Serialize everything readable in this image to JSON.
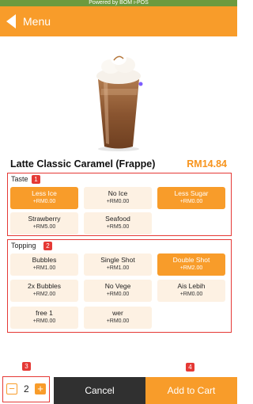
{
  "header": {
    "powered_by": "Powered by BOM i-POS",
    "back_label": "Menu"
  },
  "product": {
    "name": "Latte Classic Caramel (Frappe)",
    "price": "RM14.84"
  },
  "taste": {
    "label": "Taste",
    "badge": "1",
    "options": [
      {
        "name": "Less Ice",
        "price": "+RM0.00",
        "selected": true
      },
      {
        "name": "No Ice",
        "price": "+RM0.00",
        "selected": false
      },
      {
        "name": "Less Sugar",
        "price": "+RM0.00",
        "selected": true
      },
      {
        "name": "Strawberry",
        "price": "+RM5.00",
        "selected": false
      },
      {
        "name": "Seafood",
        "price": "+RM5.00",
        "selected": false
      }
    ]
  },
  "topping": {
    "label": "Topping",
    "badge": "2",
    "options": [
      {
        "name": "Bubbles",
        "price": "+RM1.00",
        "selected": false
      },
      {
        "name": "Single Shot",
        "price": "+RM1.00",
        "selected": false
      },
      {
        "name": "Double Shot",
        "price": "+RM2.00",
        "selected": true
      },
      {
        "name": "2x Bubbles",
        "price": "+RM2.00",
        "selected": false
      },
      {
        "name": "No Vege",
        "price": "+RM0.00",
        "selected": false
      },
      {
        "name": "Ais Lebih",
        "price": "+RM0.00",
        "selected": false
      },
      {
        "name": "free 1",
        "price": "+RM0.00",
        "selected": false
      },
      {
        "name": "wer",
        "price": "+RM0.00",
        "selected": false
      }
    ]
  },
  "footer": {
    "quantity_badge": "3",
    "quantity": "2",
    "minus_label": "−",
    "plus_label": "+",
    "cancel_label": "Cancel",
    "cart_badge": "4",
    "add_to_cart_label": "Add to Cart"
  },
  "colors": {
    "accent": "#f89c2a",
    "option_bg": "#fdf1e3",
    "annotation": "#e53935",
    "cancel_bg": "#303030"
  },
  "icons": {
    "back": "back-arrow-icon",
    "minus": "minus-icon",
    "plus": "plus-icon"
  }
}
